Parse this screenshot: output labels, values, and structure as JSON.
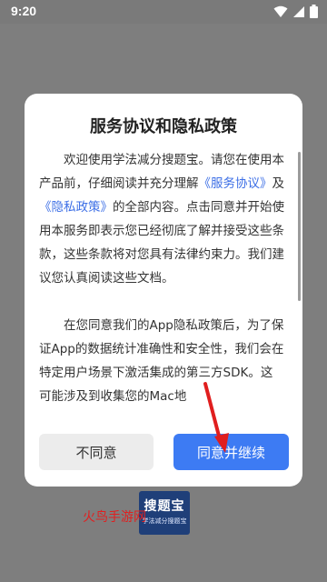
{
  "status_bar": {
    "time": "9:20",
    "icons": [
      "wifi-icon",
      "signal-icon",
      "battery-icon"
    ]
  },
  "dialog": {
    "title": "服务协议和隐私政策",
    "paragraph1": {
      "part1": "欢迎使用学法减分搜题宝。请您在使用本产品前，仔细阅读并充分理解",
      "link_service": "《服务协议》",
      "part2": "及",
      "link_privacy": "《隐私政策》",
      "part3": "的全部内容。点击同意并开始使用本服务即表示您已经彻底了解并接受这些条款，这些条款将对您具有法律约束力。我们建议您认真阅读这些文档。"
    },
    "paragraph2": "在您同意我们的App隐私政策后，为了保证App的数据统计准确性和安全性，我们会在特定用户场景下激活集成的第三方SDK。这可能涉及到收集您的Mac地",
    "buttons": {
      "decline": "不同意",
      "agree": "同意并继续"
    }
  },
  "app_logo": {
    "title": "搜题宝",
    "subtitle": "学法减分搜题宝"
  },
  "watermark": "火鸟手游网",
  "colors": {
    "accent": "#3d7bf3",
    "link": "#3d6fe6",
    "annotation_arrow": "#e01e1e",
    "overlay": "#7e7e7e"
  }
}
